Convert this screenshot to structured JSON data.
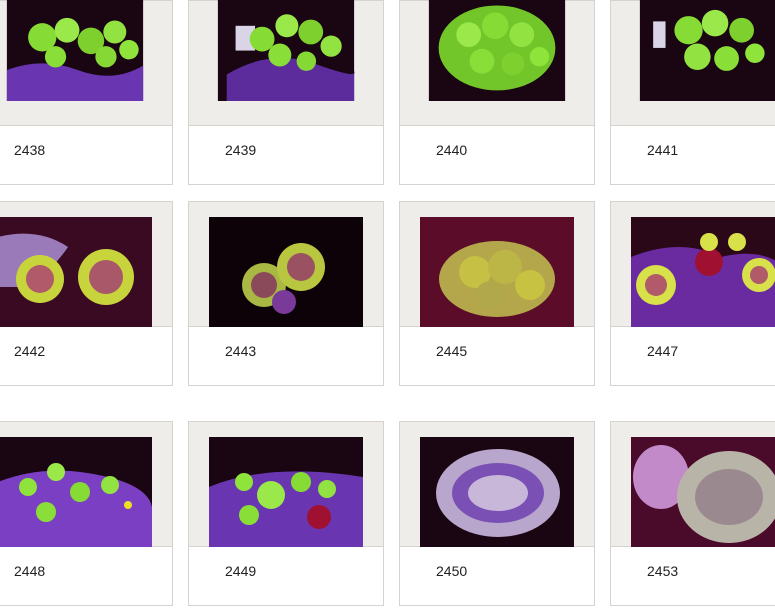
{
  "gallery": {
    "items": [
      {
        "number": "2438",
        "coral": "green-mushroom-cluster"
      },
      {
        "number": "2439",
        "coral": "green-mushroom-cluster"
      },
      {
        "number": "2440",
        "coral": "green-mushroom-mound"
      },
      {
        "number": "2441",
        "coral": "green-mushroom-cluster"
      },
      {
        "number": "2442",
        "coral": "yellow-rim-mushroom-pair"
      },
      {
        "number": "2443",
        "coral": "yellow-rim-mushroom-cluster"
      },
      {
        "number": "2445",
        "coral": "yellow-rim-mushroom-cluster"
      },
      {
        "number": "2447",
        "coral": "yellow-rim-mushroom-group"
      },
      {
        "number": "2448",
        "coral": "green-mushroom-rock"
      },
      {
        "number": "2449",
        "coral": "green-mushroom-rock"
      },
      {
        "number": "2450",
        "coral": "leather-toadstool"
      },
      {
        "number": "2453",
        "coral": "leather-toadstool"
      }
    ]
  },
  "colors": {
    "frame": "#efedea",
    "frame_border": "#d6d3cf",
    "label_text": "#222222",
    "photo_background": "#1a0612",
    "rock": "#7b3fc4",
    "green_polyp": "#8ee43a",
    "yellow_rim": "#d8e24a",
    "leather_tissue": "#c9b7d9"
  }
}
